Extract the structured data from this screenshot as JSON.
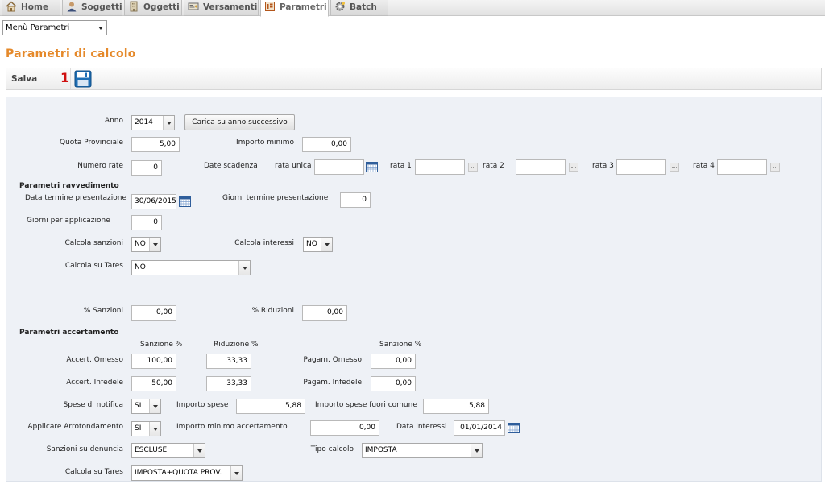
{
  "tabs": [
    {
      "label": "Home",
      "icon": "home-icon"
    },
    {
      "label": "Soggetti",
      "icon": "user-icon"
    },
    {
      "label": "Oggetti",
      "icon": "building-icon"
    },
    {
      "label": "Versamenti",
      "icon": "payment-icon"
    },
    {
      "label": "Parametri",
      "icon": "parameters-icon",
      "active": true
    },
    {
      "label": "Batch",
      "icon": "gear-icon"
    }
  ],
  "menu": {
    "selected": "Menù Parametri"
  },
  "section": {
    "title": "Parametri di calcolo"
  },
  "toolbar": {
    "save_label": "Salva",
    "badge": "1"
  },
  "form": {
    "anno": {
      "label": "Anno",
      "value": "2014",
      "button": "Carica su anno successivo"
    },
    "quota_provinciale": {
      "label": "Quota Provinciale",
      "value": "5,00"
    },
    "importo_minimo": {
      "label": "Importo minimo",
      "value": "0,00"
    },
    "numero_rate": {
      "label": "Numero rate",
      "value": "0"
    },
    "date_scadenza": {
      "label": "Date scadenza",
      "rata_unica": "rata unica",
      "rata1": "rata 1",
      "rata2": "rata 2",
      "rata3": "rata 3",
      "rata4": "rata 4"
    },
    "ravvedimento": {
      "heading": "Parametri ravvedimento",
      "data_termine": {
        "label": "Data termine presentazione",
        "value": "30/06/2015"
      },
      "giorni_termine": {
        "label": "Giorni termine presentazione",
        "value": "0"
      },
      "giorni_applicazione": {
        "label": "Giorni per applicazione",
        "value": "0"
      },
      "calcola_sanzioni": {
        "label": "Calcola sanzioni",
        "value": "NO"
      },
      "calcola_interessi": {
        "label": "Calcola interessi",
        "value": "NO"
      },
      "calcola_tares": {
        "label": "Calcola su Tares",
        "value": "NO"
      },
      "perc_sanzioni": {
        "label": "% Sanzioni",
        "value": "0,00"
      },
      "perc_riduzioni": {
        "label": "% Riduzioni",
        "value": "0,00"
      }
    },
    "accertamento": {
      "heading": "Parametri accertamento",
      "col_sanzione": "Sanzione %",
      "col_riduzione": "Riduzione %",
      "col_sanzione2": "Sanzione %",
      "omesso": {
        "label": "Accert. Omesso",
        "sanzione": "100,00",
        "riduzione": "33,33"
      },
      "infedele": {
        "label": "Accert. Infedele",
        "sanzione": "50,00",
        "riduzione": "33,33"
      },
      "pagam_omesso": {
        "label": "Pagam. Omesso",
        "value": "0,00"
      },
      "pagam_infedele": {
        "label": "Pagam. Infedele",
        "value": "0,00"
      },
      "spese_notifica": {
        "label": "Spese di notifica",
        "value": "SI"
      },
      "importo_spese": {
        "label": "Importo spese",
        "value": "5,88"
      },
      "importo_spese_fuori": {
        "label": "Importo spese fuori comune",
        "value": "5,88"
      },
      "arrotondamento": {
        "label": "Applicare Arrotondamento",
        "value": "SI"
      },
      "importo_minimo_acc": {
        "label": "Importo minimo accertamento",
        "value": "0,00"
      },
      "data_interessi": {
        "label": "Data interessi",
        "value": "01/01/2014"
      },
      "sanzioni_denuncia": {
        "label": "Sanzioni su denuncia",
        "value": "ESCLUSE"
      },
      "tipo_calcolo": {
        "label": "Tipo calcolo",
        "value": "IMPOSTA"
      },
      "calcola_tares": {
        "label": "Calcola su Tares",
        "value": "IMPOSTA+QUOTA PROV."
      }
    }
  },
  "colors": {
    "title": "#e5892a",
    "badge": "#d01010",
    "panel": "#eef1f6"
  }
}
